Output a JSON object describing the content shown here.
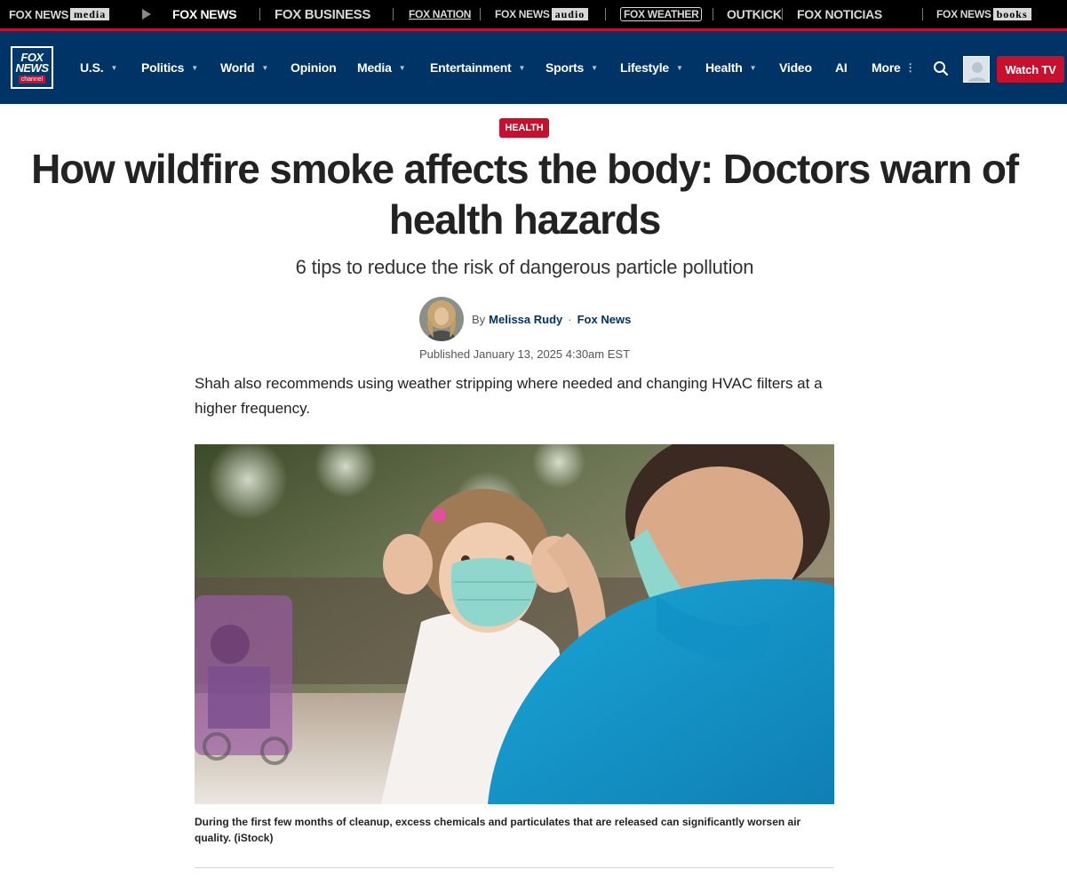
{
  "network_bar": {
    "items": [
      {
        "main": "FOX NEWS",
        "boxed": "media"
      },
      {
        "main": "FOX NEWS",
        "boxed": ""
      },
      {
        "main": "FOX BUSINESS",
        "boxed": ""
      },
      {
        "main": "FOX NATION",
        "boxed": ""
      },
      {
        "main": "FOX NEWS",
        "boxed": "audio"
      },
      {
        "main": "FOX WEATHER",
        "boxed": ""
      },
      {
        "main": "OUTKICK",
        "boxed": ""
      },
      {
        "main": "FOX NOTICIAS",
        "boxed": ""
      },
      {
        "main": "FOX NEWS",
        "boxed": "books"
      }
    ]
  },
  "logo": {
    "line1": "FOX",
    "line2": "NEWS",
    "line3": "channel"
  },
  "nav": {
    "items": [
      {
        "label": "U.S.",
        "caret": "▼"
      },
      {
        "label": "Politics",
        "caret": "▼"
      },
      {
        "label": "World",
        "caret": "▼"
      },
      {
        "label": "Opinion",
        "caret": ""
      },
      {
        "label": "Media",
        "caret": "▼"
      },
      {
        "label": "Entertainment",
        "caret": "▼"
      },
      {
        "label": "Sports",
        "caret": "▼"
      },
      {
        "label": "Lifestyle",
        "caret": "▼"
      },
      {
        "label": "Health",
        "caret": "▼"
      },
      {
        "label": "Video",
        "caret": ""
      },
      {
        "label": "AI",
        "caret": ""
      },
      {
        "label": "More",
        "caret": "⋮"
      }
    ],
    "watch_tv": "Watch TV"
  },
  "article": {
    "category": "HEALTH",
    "headline": "How wildfire smoke affects the body: Doctors warn of health hazards",
    "subheadline": "6 tips to reduce the risk of dangerous particle pollution",
    "by_prefix": "By",
    "author": "Melissa Rudy",
    "byline_sep": "·",
    "source": "Fox News",
    "published": "Published January 13, 2025 4:30am EST",
    "body": "Shah also recommends using weather stripping where needed and changing HVAC filters at a higher frequency.",
    "image_caption": "During the first few months of cleanup, excess chemicals and particulates that are released can significantly worsen air quality. (iStock)"
  },
  "colors": {
    "navy": "#003366",
    "red": "#c8102e",
    "black": "#000000"
  },
  "icons": [
    "play-icon",
    "search-icon",
    "user-avatar-icon"
  ]
}
